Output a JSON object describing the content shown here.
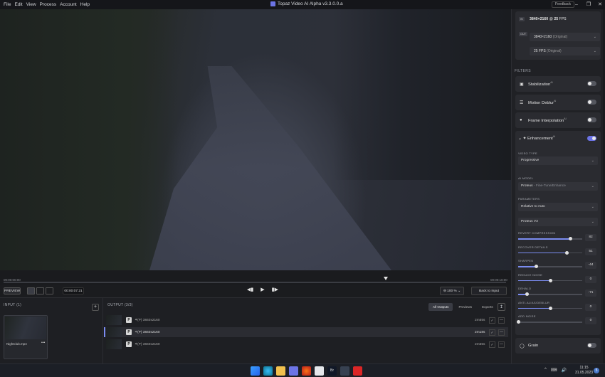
{
  "menu": [
    "File",
    "Edit",
    "View",
    "Process",
    "Account",
    "Help"
  ],
  "app_title": "Topaz Video AI Alpha  v3.3.0.0.a",
  "feedback_label": "Feedback",
  "window_controls": [
    "–",
    "❐",
    "✕"
  ],
  "timeline": {
    "start_time": "00:00:00:00",
    "end_time": "00:00:10:00",
    "playhead_fraction": 0.76
  },
  "controls": {
    "preview_label": "PREVIEW",
    "timecode": "00:00:07:21",
    "transport": [
      "◀▮",
      "▶",
      "▮▶"
    ],
    "zoom_value": "100",
    "zoom_unit": "%",
    "back_to_input": "Back to Input"
  },
  "input": {
    "title": "INPUT (1)",
    "add": "+",
    "file_name": "Nightclub.mp4",
    "file_menu": "•••"
  },
  "output": {
    "title": "OUTPUT (3/3)",
    "tabs": [
      "All Outputs",
      "Previews",
      "Exports"
    ],
    "export_icon": "↥",
    "rows": [
      {
        "p": "P",
        "tag": "(P)",
        "res": "3840x2160",
        "time": "2m55s"
      },
      {
        "p": "P",
        "tag": "(P)",
        "res": "3840x2160",
        "time": "2m18s"
      },
      {
        "p": "P",
        "tag": "(P)",
        "res": "3840x2160",
        "time": "2m55s"
      }
    ],
    "check": "✓",
    "more": "—"
  },
  "panel": {
    "in_badge": "IN",
    "out_badge": "OUT",
    "input_res": "3840×2160",
    "input_at": "@",
    "input_fps": "25",
    "input_fps_unit": "FPS",
    "output_res": "3840×2160",
    "output_res_note": "(Original)",
    "output_fps": "25 FPS",
    "output_fps_note": "(Original)",
    "filters_label": "FILTERS",
    "filters": [
      {
        "label": "Stabilization",
        "sup": "AI",
        "on": false
      },
      {
        "label": "Motion Deblur",
        "sup": "AI",
        "on": false
      },
      {
        "label": "Frame Interpolation",
        "sup": "AI",
        "on": false
      }
    ],
    "enhancement": {
      "label": "Enhancement",
      "sup": "AI",
      "chevron": "⌄",
      "video_type_label": "VIDEO TYPE",
      "video_type": "Progressive",
      "ai_model_label": "AI MODEL",
      "ai_model": "Proteus",
      "ai_model_note": "- Fine-Tune/Enhance",
      "parameters_label": "PARAMETERS",
      "param_mode": "Relative to Auto",
      "param_version": "Proteus V3",
      "sliders": [
        {
          "label": "REVERT COMPRESSION",
          "value": "82",
          "fraction": 0.82
        },
        {
          "label": "RECOVER DETAILS",
          "value": "51",
          "fraction": 0.76
        },
        {
          "label": "SHARPEN",
          "value": "-44",
          "fraction": 0.28
        },
        {
          "label": "REDUCE NOISE",
          "value": "0",
          "fraction": 0.5
        },
        {
          "label": "DEHALO",
          "value": "-71",
          "fraction": 0.14
        },
        {
          "label": "ANTI-ALIAS/DEBLUR",
          "value": "0",
          "fraction": 0.5
        },
        {
          "label": "ADD NOISE",
          "value": "0",
          "fraction": 0.0
        }
      ]
    },
    "grain": {
      "label": "Grain",
      "on": false
    }
  },
  "taskbar": {
    "clock_time": "11:15",
    "clock_date": "31.05.2023",
    "notification_count": "5",
    "tray": [
      "^",
      "⌨",
      "🔊"
    ]
  },
  "colors": {
    "accent": "#6c74e6",
    "slider_fill": "#7b8cf0"
  }
}
